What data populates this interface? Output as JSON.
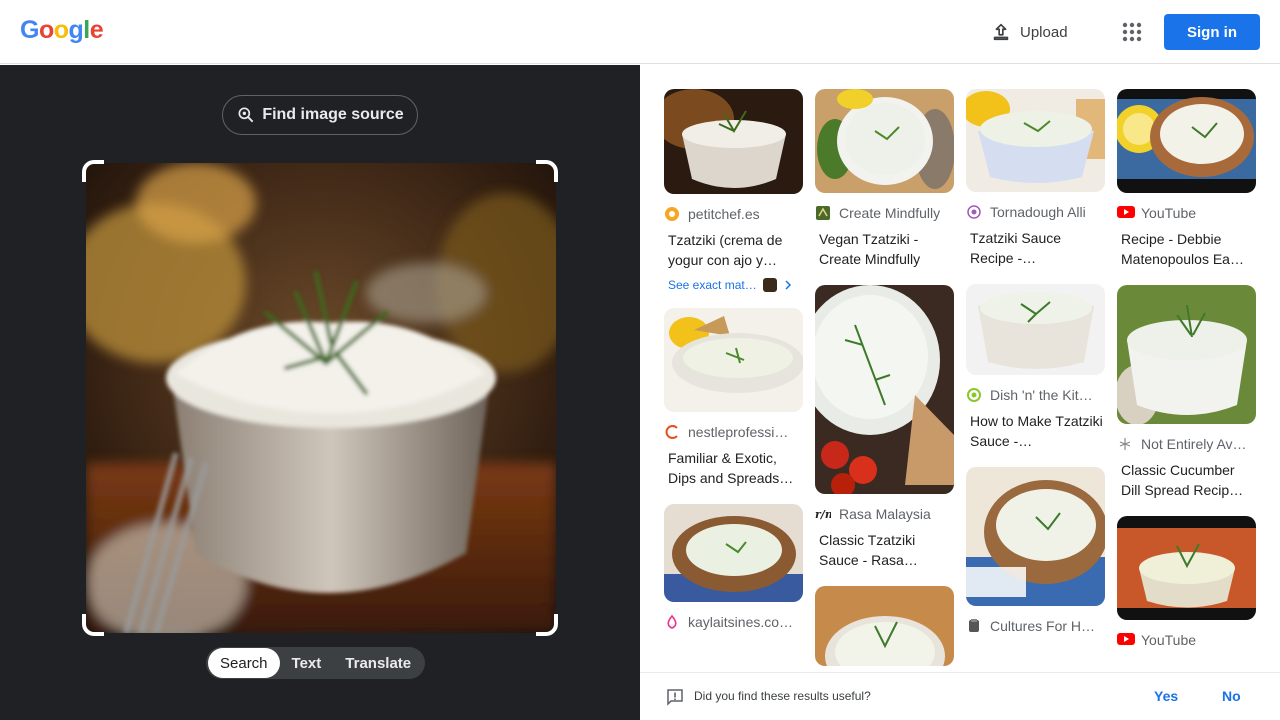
{
  "header": {
    "logo_text": "Google",
    "upload_label": "Upload",
    "signin_label": "Sign in",
    "upload_icon": "upload-icon",
    "apps_icon": "apps-grid-icon"
  },
  "left": {
    "find_source_label": "Find image source",
    "modes": [
      "Search",
      "Text",
      "Translate"
    ],
    "active_mode": "Search"
  },
  "results": {
    "col1": [
      {
        "source": "petitchef.es",
        "title": "Tzatziki (crema de yogur con ajo y…",
        "exact": "See exact mat…"
      },
      {
        "source": "nestleprofessi…",
        "title": "Familiar & Exotic, Dips and Spreads…"
      },
      {
        "source": "kaylaitsines.co…",
        "title": ""
      }
    ],
    "col2": [
      {
        "source": "Create Mindfully",
        "title": "Vegan Tzatziki - Create Mindfully"
      },
      {
        "source": "Rasa Malaysia",
        "title": "Classic Tzatziki Sauce - Rasa…"
      },
      {
        "source": "",
        "title": ""
      }
    ],
    "col3": [
      {
        "source": "Tornadough Alli",
        "title": "Tzatziki Sauce Recipe -…"
      },
      {
        "source": "Dish 'n' the Kit…",
        "title": "How to Make Tzatziki Sauce -…"
      },
      {
        "source": "Cultures For H…",
        "title": ""
      }
    ],
    "col4": [
      {
        "source": "YouTube",
        "title": "Recipe - Debbie Matenopoulos Ea…"
      },
      {
        "source": "Not Entirely Av…",
        "title": "Classic Cucumber Dill Spread Recip…"
      },
      {
        "source": "YouTube",
        "title": ""
      }
    ]
  },
  "feedback": {
    "question": "Did you find these results useful?",
    "yes": "Yes",
    "no": "No"
  },
  "colors": {
    "brand_blue": "#1a73e8",
    "panel_dark": "#202124"
  }
}
